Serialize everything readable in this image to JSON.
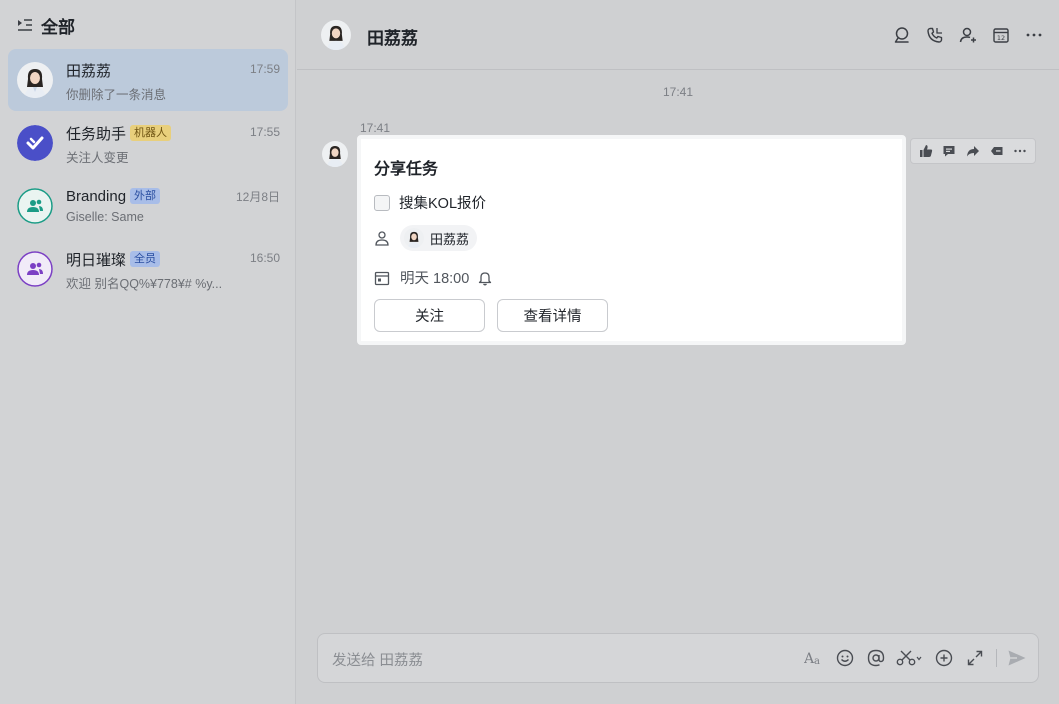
{
  "sidebar": {
    "title": "全部",
    "items": [
      {
        "name": "田荔荔",
        "tag": "",
        "time": "17:59",
        "preview": "你删除了一条消息"
      },
      {
        "name": "任务助手",
        "tag": "机器人",
        "time": "17:55",
        "preview": "关注人变更"
      },
      {
        "name": "Branding",
        "tag": "外部",
        "time": "12月8日",
        "preview": "Giselle: Same"
      },
      {
        "name": "明日璀璨",
        "tag": "全员",
        "time": "16:50",
        "preview": "欢迎 别名QQ%¥778¥# %y..."
      }
    ]
  },
  "header": {
    "title": "田荔荔",
    "icons": [
      "search-chat-icon",
      "phone-icon",
      "add-member-icon",
      "calendar-icon",
      "more-icon"
    ]
  },
  "conversation": {
    "center_time": "17:41",
    "message_time": "17:41",
    "task_card": {
      "title": "分享任务",
      "task_name": "搜集KOL报价",
      "assignee": "田荔荔",
      "due": "明天 18:00",
      "follow_label": "关注",
      "details_label": "查看详情"
    },
    "reaction_icons": [
      "thumbs-up-icon",
      "reply-icon",
      "forward-icon",
      "ding-icon",
      "more-icon"
    ]
  },
  "composer": {
    "placeholder": "发送给 田荔荔",
    "icons": [
      "font-format-icon",
      "emoji-icon",
      "mention-icon",
      "scissors-icon",
      "plus-icon",
      "expand-icon",
      "send-icon"
    ]
  },
  "colors": {
    "selected_item": "#bccadb",
    "task_bot": "#4a4fc8",
    "branding": "#1a9c86",
    "mingri": "#7b3fc4"
  }
}
